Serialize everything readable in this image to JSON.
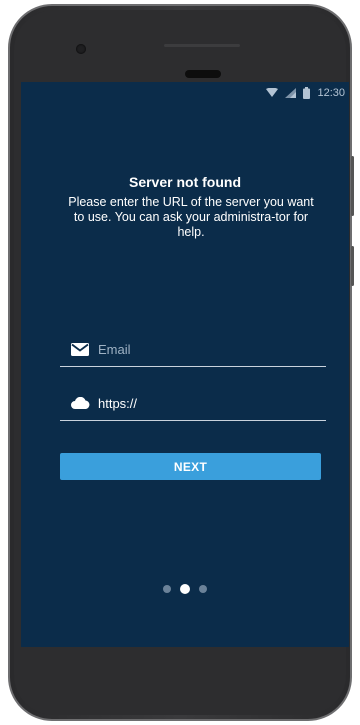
{
  "status_bar": {
    "time": "12:30",
    "icons": [
      "wifi-icon",
      "signal-icon",
      "battery-icon"
    ]
  },
  "setup": {
    "title": "Server not found",
    "description": "Please enter the URL of the server you want to use. You can ask your administra-tor for help."
  },
  "form": {
    "email": {
      "icon": "envelope-icon",
      "placeholder": "Email",
      "value": ""
    },
    "server": {
      "icon": "cloud-icon",
      "placeholder": "",
      "value": "https://"
    },
    "next_label": "NEXT"
  },
  "pager": {
    "count": 3,
    "active_index": 1
  },
  "colors": {
    "screen_background": "#0b2c4a",
    "accent": "#3a9fdc",
    "text": "#ffffff"
  }
}
